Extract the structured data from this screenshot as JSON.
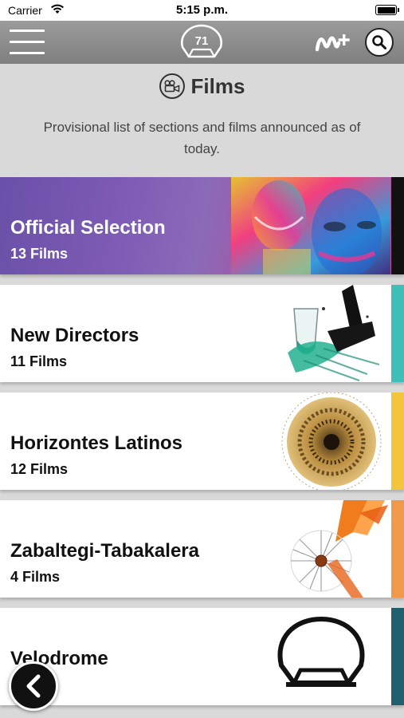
{
  "status_bar": {
    "carrier": "Carrier",
    "time": "5:15 p.m."
  },
  "nav": {
    "logo_number": "71",
    "brand": "M+",
    "search_icon": "search-icon",
    "menu_icon": "hamburger-icon"
  },
  "header": {
    "title": "Films",
    "subtitle": "Provisional list of sections and films announced as of today.",
    "title_icon": "film-camera-icon"
  },
  "sections": [
    {
      "name": "Official Selection",
      "count": "13 Films",
      "accent": "#111111"
    },
    {
      "name": "New Directors",
      "count": "11 Films",
      "accent": "#3fbfb7"
    },
    {
      "name": "Horizontes Latinos",
      "count": "12 Films",
      "accent": "#f2c53d"
    },
    {
      "name": "Zabaltegi-Tabakalera",
      "count": "4 Films",
      "accent": "#f0994a"
    },
    {
      "name": "Velodrome",
      "count": "",
      "accent": "#1f5f6e"
    }
  ],
  "back_button": {
    "icon": "chevron-left-icon"
  }
}
